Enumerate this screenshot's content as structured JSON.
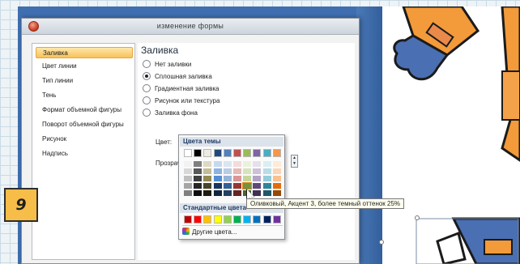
{
  "dialog": {
    "title": "изменение формы"
  },
  "sidebar": {
    "items": [
      {
        "label": "Заливка",
        "active": true
      },
      {
        "label": "Цвет линии",
        "active": false
      },
      {
        "label": "Тип линии",
        "active": false
      },
      {
        "label": "Тень",
        "active": false
      },
      {
        "label": "Формат объемной фигуры",
        "active": false
      },
      {
        "label": "Поворот объемной фигуры",
        "active": false
      },
      {
        "label": "Рисунок",
        "active": false
      },
      {
        "label": "Надпись",
        "active": false
      }
    ]
  },
  "fill": {
    "section_title": "Заливка",
    "options": [
      {
        "label": "Нет заливки",
        "checked": false
      },
      {
        "label": "Сплошная заливка",
        "checked": true
      },
      {
        "label": "Градиентная заливка",
        "checked": false
      },
      {
        "label": "Рисунок или текстура",
        "checked": false
      },
      {
        "label": "Заливка фона",
        "checked": false
      }
    ],
    "color_label": "Цвет:",
    "transparency_label": "Прозрачн",
    "color_button_icon": "paint-bucket-icon",
    "dropdown_icon": "chevron-down-icon"
  },
  "palette": {
    "theme_header": "Цвета темы",
    "standard_header": "Стандартные цвета",
    "more_colors": "Другие цвета...",
    "theme_colors": [
      "#ffffff",
      "#000000",
      "#eeece1",
      "#1f497d",
      "#4f81bd",
      "#c0504d",
      "#9bbb59",
      "#8064a2",
      "#4bacc6",
      "#f79646"
    ],
    "tint_rows": [
      [
        "#f2f2f2",
        "#7f7f7f",
        "#ddd9c3",
        "#c6d9f0",
        "#dbe5f1",
        "#f2dcdb",
        "#ebf1dd",
        "#e5e0ec",
        "#dbeef3",
        "#fdeada"
      ],
      [
        "#d8d8d8",
        "#595959",
        "#c4bd97",
        "#8db3e2",
        "#b8cce4",
        "#e5b9b7",
        "#d7e3bc",
        "#ccc1d9",
        "#b7dde8",
        "#fbd5b5"
      ],
      [
        "#bfbfbf",
        "#3f3f3f",
        "#938953",
        "#548dd4",
        "#95b3d7",
        "#d99694",
        "#c3d69b",
        "#b2a2c7",
        "#92cddc",
        "#fac08f"
      ],
      [
        "#a5a5a5",
        "#262626",
        "#494429",
        "#17365d",
        "#366092",
        "#953734",
        "#76923c",
        "#5f497a",
        "#31859b",
        "#e36c09"
      ],
      [
        "#7f7f7f",
        "#0c0c0c",
        "#1d1b10",
        "#0f243e",
        "#244061",
        "#632423",
        "#4f6128",
        "#3f3151",
        "#205867",
        "#974806"
      ]
    ],
    "standard_colors": [
      "#c00000",
      "#ff0000",
      "#ffc000",
      "#ffff00",
      "#92d050",
      "#00b050",
      "#00b0f0",
      "#0070c0",
      "#002060",
      "#7030a0"
    ],
    "selected": {
      "row": 3,
      "col": 6
    }
  },
  "tooltip": {
    "text": "Оливковый, Акцент 3, более темный оттенок 25%"
  },
  "step": {
    "number": "9"
  }
}
